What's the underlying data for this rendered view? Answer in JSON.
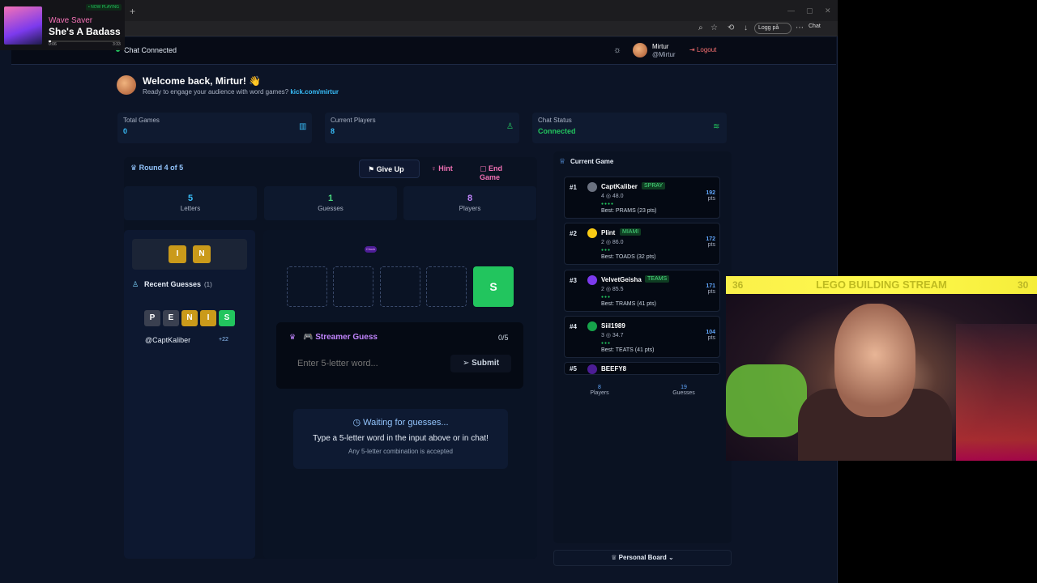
{
  "now_playing": {
    "badge": "• NOW PLAYING",
    "artist": "Wave Saver",
    "title": "She's A Badass",
    "time_elapsed": "0:06",
    "time_total": "3:33",
    "progress": 0.03
  },
  "browser": {
    "new_tab": "+",
    "login_pill": "Logg på",
    "chat_btn": "Chat"
  },
  "header": {
    "chat_status": "Chat Connected",
    "user_name": "Mirtur",
    "user_handle": "@Mirtur",
    "logout": "Logout"
  },
  "welcome": {
    "title": "Welcome back, Mirtur! 👋",
    "subtitle": "Ready to engage your audience with word games?",
    "link": "kick.com/mirtur"
  },
  "stats": [
    {
      "label": "Total Games",
      "value": "0",
      "color": "#38bdf8",
      "icon": "bar-chart-icon"
    },
    {
      "label": "Current Players",
      "value": "8",
      "color": "#38bdf8",
      "icon": "user-icon"
    },
    {
      "label": "Chat Status",
      "value": "Connected",
      "color": "#22c55e",
      "icon": "wifi-icon"
    }
  ],
  "game": {
    "round": "Round 4 of 5",
    "give_up": "Give Up",
    "hint": "Hint",
    "end_game": "End Game",
    "info": [
      {
        "num": "5",
        "label": "Letters",
        "color": "#38bdf8"
      },
      {
        "num": "1",
        "label": "Guesses",
        "color": "#4ade80"
      },
      {
        "num": "8",
        "label": "Players",
        "color": "#c084fc"
      }
    ],
    "known_letters": [
      "I",
      "N"
    ],
    "recent_guesses_title": "Recent Guesses",
    "recent_guesses_count": "(1)",
    "recent_guess_letters": [
      {
        "l": "P",
        "s": "gray"
      },
      {
        "l": "E",
        "s": "gray"
      },
      {
        "l": "N",
        "s": "yellow"
      },
      {
        "l": "I",
        "s": "yellow"
      },
      {
        "l": "S",
        "s": "green"
      }
    ],
    "recent_guess_user": "@CaptKaliber",
    "recent_guess_pts": "+22",
    "board_badge": "Chuck",
    "board_last": "S",
    "streamer_guess_title": "🎮 Streamer Guess",
    "streamer_guess_count": "0/5",
    "input_placeholder": "Enter 5-letter word...",
    "submit": "Submit",
    "waiting_title": "Waiting for guesses...",
    "waiting_line1": "Type a 5-letter word in the input above or in chat!",
    "waiting_line2": "Any 5-letter combination is accepted"
  },
  "leaderboard": {
    "title": "Current Game",
    "entries": [
      {
        "rank": "#1",
        "name": "CaptKaliber",
        "tag": "SPRAY",
        "stats": "4 ◎ 48.0",
        "best": "Best: PRAMS (23 pts)",
        "pts": "192"
      },
      {
        "rank": "#2",
        "name": "Plint",
        "tag": "MIAMI",
        "stats": "2 ◎ 86.0",
        "best": "Best: TOADS (32 pts)",
        "pts": "172"
      },
      {
        "rank": "#3",
        "name": "VelvetGeisha",
        "tag": "TEAMS",
        "stats": "2 ◎ 85.5",
        "best": "Best: TRAMS (41 pts)",
        "pts": "171"
      },
      {
        "rank": "#4",
        "name": "Siil1989",
        "tag": "",
        "stats": "3 ◎ 34.7",
        "best": "Best: TEATS (41 pts)",
        "pts": "104"
      },
      {
        "rank": "#5",
        "name": "BEEFY8",
        "tag": "",
        "stats": "",
        "best": "",
        "pts": ""
      }
    ],
    "pts_label": "pts",
    "footer_players_num": "8",
    "footer_players_label": "Players",
    "footer_guesses_num": "19",
    "footer_guesses_label": "Guesses",
    "personal_board": "Personal Board"
  },
  "webcam": {
    "banner": "LEGO BUILDING STREAM",
    "num_left": "36",
    "num_right": "30"
  }
}
